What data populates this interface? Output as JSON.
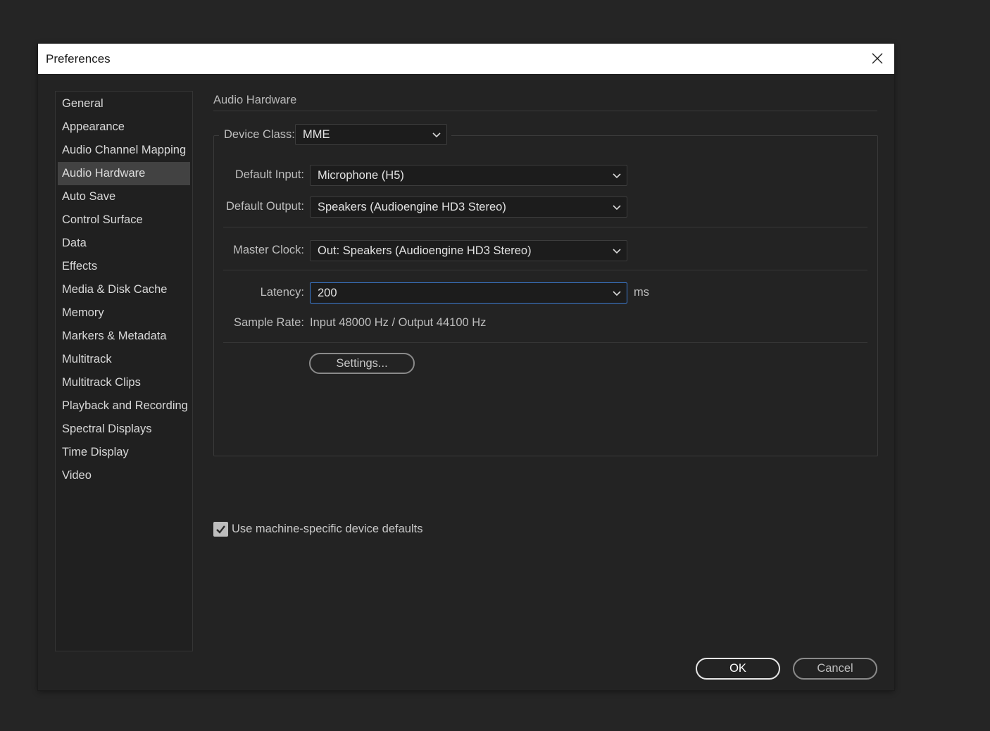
{
  "window": {
    "title": "Preferences"
  },
  "sidebar": {
    "items": [
      {
        "label": "General"
      },
      {
        "label": "Appearance"
      },
      {
        "label": "Audio Channel Mapping"
      },
      {
        "label": "Audio Hardware",
        "selected": true
      },
      {
        "label": "Auto Save"
      },
      {
        "label": "Control Surface"
      },
      {
        "label": "Data"
      },
      {
        "label": "Effects"
      },
      {
        "label": "Media & Disk Cache"
      },
      {
        "label": "Memory"
      },
      {
        "label": "Markers & Metadata"
      },
      {
        "label": "Multitrack"
      },
      {
        "label": "Multitrack Clips"
      },
      {
        "label": "Playback and Recording"
      },
      {
        "label": "Spectral Displays"
      },
      {
        "label": "Time Display"
      },
      {
        "label": "Video"
      }
    ]
  },
  "panel": {
    "title": "Audio Hardware",
    "device_class": {
      "label": "Device Class:",
      "value": "MME"
    },
    "default_input": {
      "label": "Default Input:",
      "value": "Microphone (H5)"
    },
    "default_output": {
      "label": "Default Output:",
      "value": "Speakers (Audioengine HD3 Stereo)"
    },
    "master_clock": {
      "label": "Master Clock:",
      "value": "Out: Speakers (Audioengine HD3 Stereo)"
    },
    "latency": {
      "label": "Latency:",
      "value": "200",
      "unit": "ms"
    },
    "sample_rate": {
      "label": "Sample Rate:",
      "value": "Input 48000 Hz / Output 44100 Hz"
    },
    "settings_button": "Settings...",
    "machine_defaults": {
      "label": "Use machine-specific device defaults",
      "checked": true
    }
  },
  "footer": {
    "ok_label": "OK",
    "cancel_label": "Cancel"
  },
  "icons": {
    "close": "close-icon",
    "dropdown": "chevron-down-icon",
    "check": "checkmark-icon"
  },
  "colors": {
    "background": "#252525",
    "dialog": "#232323",
    "selected_item": "#424242",
    "focus_border": "#3a7ad0"
  }
}
